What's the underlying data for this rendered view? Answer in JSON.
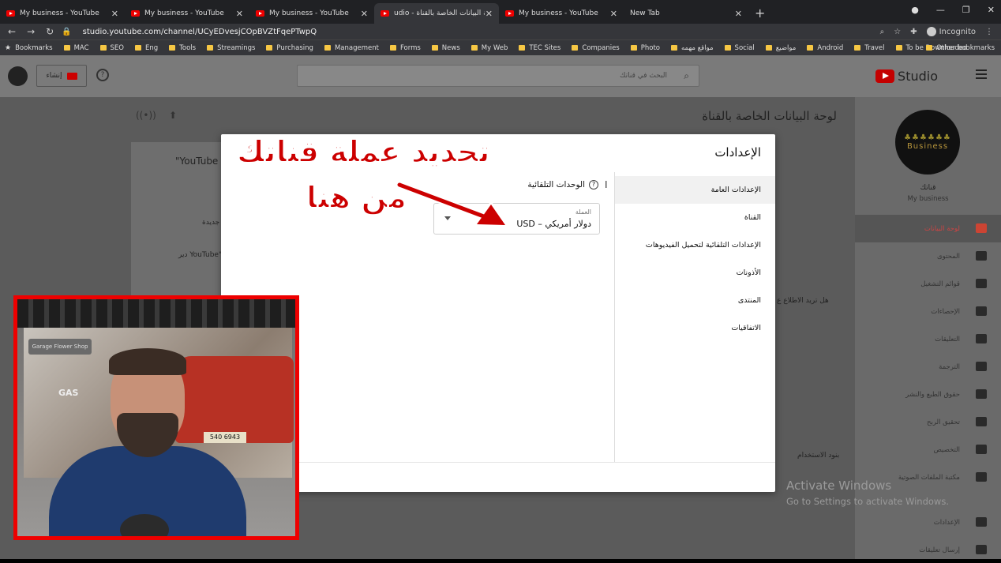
{
  "browser": {
    "tabs": [
      {
        "title": "My business - YouTube",
        "active": false
      },
      {
        "title": "My business - YouTube",
        "active": false
      },
      {
        "title": "My business - YouTube",
        "active": false
      },
      {
        "title": "udio - لوحة البيانات الخاصة بالقناة",
        "active": true
      },
      {
        "title": "My business - YouTube",
        "active": false
      },
      {
        "title": "New Tab",
        "active": false
      }
    ],
    "new_tab": "+",
    "url": "studio.youtube.com/channel/UCyEDvesjCOpBVZtFqePTwpQ",
    "incognito_label": "Incognito",
    "bookmarks": [
      "Bookmarks",
      "MAC",
      "SEO",
      "Eng",
      "Tools",
      "Streamings",
      "Purchasing",
      "Management",
      "Forms",
      "News",
      "My Web",
      "TEC Sites",
      "Companies",
      "Photo",
      "مواقع مهمه",
      "Social",
      "مواضيع",
      "Android",
      "Travel",
      "To be Downloaded"
    ],
    "other_bookmarks": "Other bookmarks"
  },
  "studio": {
    "logo_text": "Studio",
    "search_placeholder": "البحث في قناتك",
    "create_label": "إنشاء",
    "page_title": "لوحة البيانات الخاصة بالقناة",
    "bg_texts": {
      "youtube_q": "\"YouTube",
      "new": "جديدة",
      "yt_video": "دير YouTube\"",
      "want_know": "هل تريد الاطلاع ع",
      "terms": "بنود الاستخدام"
    },
    "channel": {
      "label": "قناتك",
      "name": "My business",
      "logo_text": "Business"
    },
    "sidebar": [
      {
        "label": "لوحة البيانات",
        "active": true
      },
      {
        "label": "المحتوى",
        "active": false
      },
      {
        "label": "قوائم التشغيل",
        "active": false
      },
      {
        "label": "الإحصاءات",
        "active": false
      },
      {
        "label": "التعليقات",
        "active": false
      },
      {
        "label": "الترجمة",
        "active": false
      },
      {
        "label": "حقوق الطبع والنشر",
        "active": false
      },
      {
        "label": "تحقيق الربح",
        "active": false
      },
      {
        "label": "التخصيص",
        "active": false
      },
      {
        "label": "مكتبة الملفات الصوتية",
        "active": false
      },
      {
        "label": "الإعدادات",
        "active": false
      },
      {
        "label": "إرسال تعليقات",
        "active": false
      }
    ]
  },
  "dialog": {
    "title": "الإعدادات",
    "nav": [
      {
        "label": "الإعدادات العامة",
        "selected": true
      },
      {
        "label": "القناة",
        "selected": false
      },
      {
        "label": "الإعدادات التلقائية لتحميل الفيديوهات",
        "selected": false
      },
      {
        "label": "الأذونات",
        "selected": false
      },
      {
        "label": "المنتدى",
        "selected": false
      },
      {
        "label": "الاتفاقيات",
        "selected": false
      }
    ],
    "units_heading": "الوحدات التلقائية",
    "currency_label": "العملة",
    "currency_value": "USD – دولار أمريكي"
  },
  "annotation": {
    "line1": "تحديد عملة قناتك",
    "line2": "من هنا",
    "color": "#cc0000"
  },
  "webcam": {
    "sign": "Garage Flower Shop",
    "gas": "GAS",
    "plate": "540 6943"
  },
  "watermark": {
    "line1": "Activate Windows",
    "line2": "Go to Settings to activate Windows."
  }
}
